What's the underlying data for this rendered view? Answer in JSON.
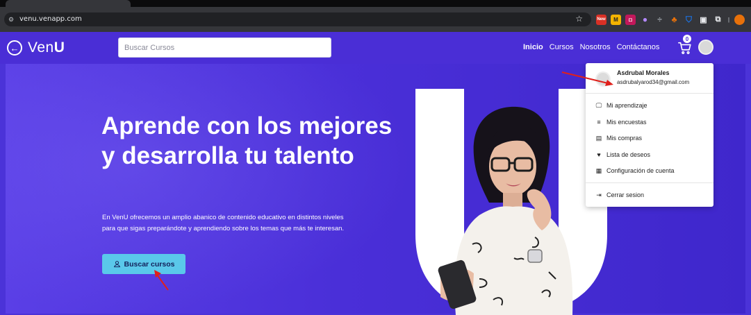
{
  "browser": {
    "url": "venu.venapp.com",
    "extensions": [
      {
        "name": "new-extension-icon",
        "label": "New",
        "color": "#d93025"
      },
      {
        "name": "tag-extension-icon",
        "label": "M",
        "color": "#f4b400"
      },
      {
        "name": "pocket-extension-icon",
        "label": "",
        "color": "#c2185b"
      },
      {
        "name": "bubble-extension-icon",
        "label": "",
        "color": "#8e24aa"
      },
      {
        "name": "paint-extension-icon",
        "label": "",
        "color": "#e8710a"
      },
      {
        "name": "shield-extension-icon",
        "label": "",
        "color": "#1a73e8"
      }
    ]
  },
  "site": {
    "logo": {
      "prefix": "Ven",
      "suffix": "U"
    },
    "search": {
      "placeholder": "Buscar Cursos"
    },
    "nav": {
      "inicio": "Inicio",
      "cursos": "Cursos",
      "nosotros": "Nosotros",
      "contactanos": "Contáctanos"
    },
    "cart_count": "0",
    "hero": {
      "title": "Aprende con los mejores y desarrolla tu talento",
      "description": "En VenU ofrecemos un amplio abanico de contenido educativo en distintos niveles para que sigas preparándote y aprendiendo sobre los temas que más te interesan.",
      "cta_label": "Buscar cursos"
    },
    "user_menu": {
      "name": "Asdrubal Morales",
      "email": "asdrubalyarod34@gmail.com",
      "items": [
        {
          "label": "Mi aprendizaje",
          "icon": "monitor-icon"
        },
        {
          "label": "Mis encuestas",
          "icon": "list-icon"
        },
        {
          "label": "Mis compras",
          "icon": "receipt-icon"
        },
        {
          "label": "Lista de deseos",
          "icon": "heart-icon"
        },
        {
          "label": "Configuración de cuenta",
          "icon": "settings-icon"
        }
      ],
      "logout_label": "Cerrar sesion"
    }
  },
  "colors": {
    "brand": "#4a2ed6",
    "cta": "#5ac8ea",
    "annotation": "#e0201b"
  }
}
